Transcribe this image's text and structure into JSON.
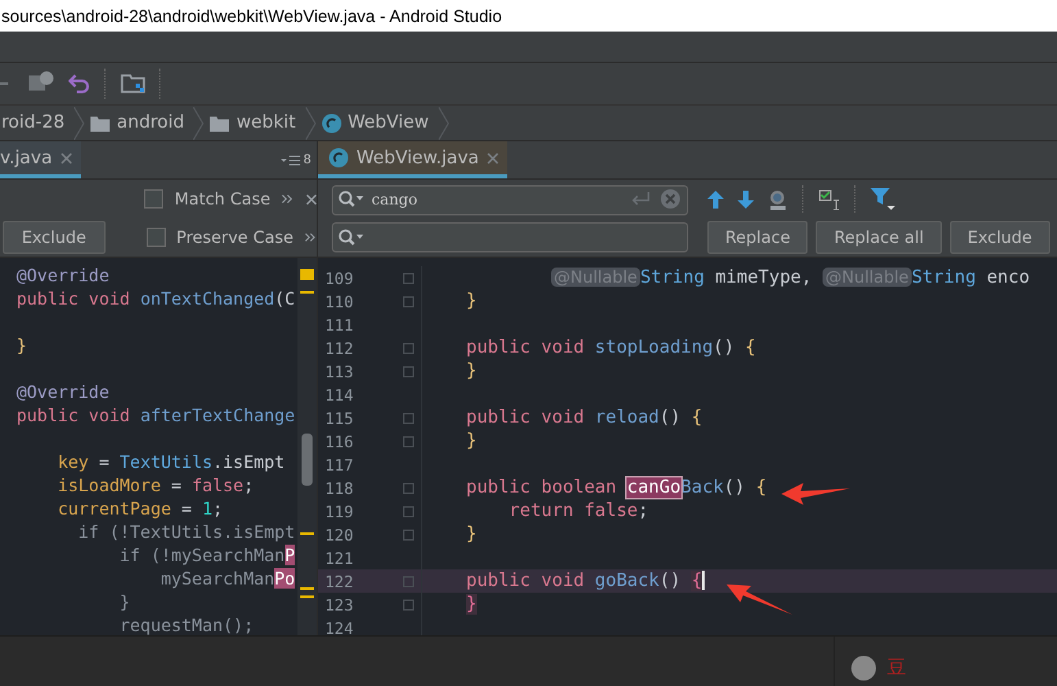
{
  "window": {
    "title": "sources\\android-28\\android\\webkit\\WebView.java - Android Studio"
  },
  "breadcrumb": [
    {
      "label": "roid-28",
      "kind": "module"
    },
    {
      "label": "android",
      "kind": "folder"
    },
    {
      "label": "webkit",
      "kind": "folder"
    },
    {
      "label": "WebView",
      "kind": "class"
    }
  ],
  "left_pane": {
    "tab": {
      "label": "v.java",
      "selected": false
    },
    "tab_count": "8",
    "options": [
      {
        "label": "Match Case",
        "checked": false
      },
      {
        "label": "Preserve Case",
        "checked": false
      }
    ],
    "exclude_button": "Exclude",
    "code": [
      {
        "tokens": [
          {
            "text": "@Override",
            "kind": "ann"
          }
        ]
      },
      {
        "tokens": [
          {
            "text": "public void ",
            "kind": "kw"
          },
          {
            "text": "onTextChanged",
            "kind": "fn"
          },
          {
            "text": "(C",
            "kind": "plain"
          }
        ]
      },
      {
        "kind": "blank"
      },
      {
        "tokens": [
          {
            "text": "}",
            "kind": "brace"
          }
        ]
      },
      {
        "kind": "blank"
      },
      {
        "tokens": [
          {
            "text": "@Override",
            "kind": "ann"
          }
        ]
      },
      {
        "tokens": [
          {
            "text": "public void ",
            "kind": "kw"
          },
          {
            "text": "afterTextChange",
            "kind": "fn"
          }
        ]
      },
      {
        "kind": "blank"
      },
      {
        "tokens": [
          {
            "text": "    key",
            "kind": "var"
          },
          {
            "text": " = ",
            "kind": "plain"
          },
          {
            "text": "TextUtils",
            "kind": "type"
          },
          {
            "text": ".isEmpt",
            "kind": "plain"
          }
        ]
      },
      {
        "tokens": [
          {
            "text": "    isLoadMore",
            "kind": "var"
          },
          {
            "text": " = ",
            "kind": "plain"
          },
          {
            "text": "false",
            "kind": "kw"
          },
          {
            "text": ";",
            "kind": "plain"
          }
        ]
      },
      {
        "tokens": [
          {
            "text": "    currentPage",
            "kind": "var"
          },
          {
            "text": " = ",
            "kind": "plain"
          },
          {
            "text": "1",
            "kind": "num"
          },
          {
            "text": ";",
            "kind": "plain"
          }
        ]
      },
      {
        "tokens": [
          {
            "text": "      if (!TextUtils.isEmpt",
            "kind": "dim"
          }
        ]
      },
      {
        "tokens": [
          {
            "text": "          if (!mySearchMan",
            "kind": "dim"
          },
          {
            "text": "P",
            "kind": "occur"
          }
        ]
      },
      {
        "tokens": [
          {
            "text": "              mySearchMan",
            "kind": "dim"
          },
          {
            "text": "Po",
            "kind": "occur"
          }
        ]
      },
      {
        "tokens": [
          {
            "text": "          }",
            "kind": "dim"
          }
        ]
      },
      {
        "tokens": [
          {
            "text": "          requestMan();",
            "kind": "dim"
          }
        ]
      }
    ]
  },
  "right_pane": {
    "tab": {
      "label": "WebView.java",
      "selected": true
    },
    "search": {
      "value": "cango"
    },
    "buttons": [
      "Replace",
      "Replace all",
      "Exclude"
    ],
    "code": [
      {
        "number": "109",
        "current": false,
        "tokens": [
          {
            "text": "@Nullable",
            "kind": "chip"
          },
          {
            "text": "String",
            "kind": "type"
          },
          {
            "text": " mimeType, ",
            "kind": "plain"
          },
          {
            "text": "@Nullable",
            "kind": "chip"
          },
          {
            "text": "String",
            "kind": "type"
          },
          {
            "text": " enco",
            "kind": "plain"
          }
        ]
      },
      {
        "number": "110",
        "current": false,
        "tokens": [
          {
            "text": "}",
            "kind": "brace"
          }
        ]
      },
      {
        "number": "111",
        "current": false
      },
      {
        "number": "112",
        "current": false,
        "tokens": [
          {
            "text": "public void ",
            "kind": "kw"
          },
          {
            "text": "stopLoading",
            "kind": "fn"
          },
          {
            "text": "() ",
            "kind": "plain"
          },
          {
            "text": "{",
            "kind": "brace"
          }
        ]
      },
      {
        "number": "113",
        "current": false,
        "tokens": [
          {
            "text": "}",
            "kind": "brace"
          }
        ]
      },
      {
        "number": "114",
        "current": false
      },
      {
        "number": "115",
        "current": false,
        "tokens": [
          {
            "text": "public void ",
            "kind": "kw"
          },
          {
            "text": "reload",
            "kind": "fn"
          },
          {
            "text": "() ",
            "kind": "plain"
          },
          {
            "text": "{",
            "kind": "brace"
          }
        ]
      },
      {
        "number": "116",
        "current": false,
        "tokens": [
          {
            "text": "}",
            "kind": "brace"
          }
        ]
      },
      {
        "number": "117",
        "current": false
      },
      {
        "number": "118",
        "current": false,
        "tokens": [
          {
            "text": "public boolean ",
            "kind": "kw"
          },
          {
            "text": "canGo",
            "kind": "match"
          },
          {
            "text": "Back",
            "kind": "fn"
          },
          {
            "text": "() ",
            "kind": "plain"
          },
          {
            "text": "{",
            "kind": "brace"
          }
        ]
      },
      {
        "number": "119",
        "current": false,
        "tokens": [
          {
            "text": "    return false",
            "kind": "kw"
          },
          {
            "text": ";",
            "kind": "plain"
          }
        ]
      },
      {
        "number": "120",
        "current": false,
        "tokens": [
          {
            "text": "}",
            "kind": "brace"
          }
        ]
      },
      {
        "number": "121",
        "current": false
      },
      {
        "number": "122",
        "current": true,
        "tokens": [
          {
            "text": "public void ",
            "kind": "kw"
          },
          {
            "text": "goBack",
            "kind": "fn"
          },
          {
            "text": "() ",
            "kind": "plain"
          },
          {
            "text": "{",
            "kind": "bracematch"
          }
        ]
      },
      {
        "number": "123",
        "current": false,
        "tokens": [
          {
            "text": "}",
            "kind": "bracematch"
          }
        ]
      },
      {
        "number": "124",
        "current": false
      }
    ]
  },
  "status_item": {
    "label": "豆"
  }
}
